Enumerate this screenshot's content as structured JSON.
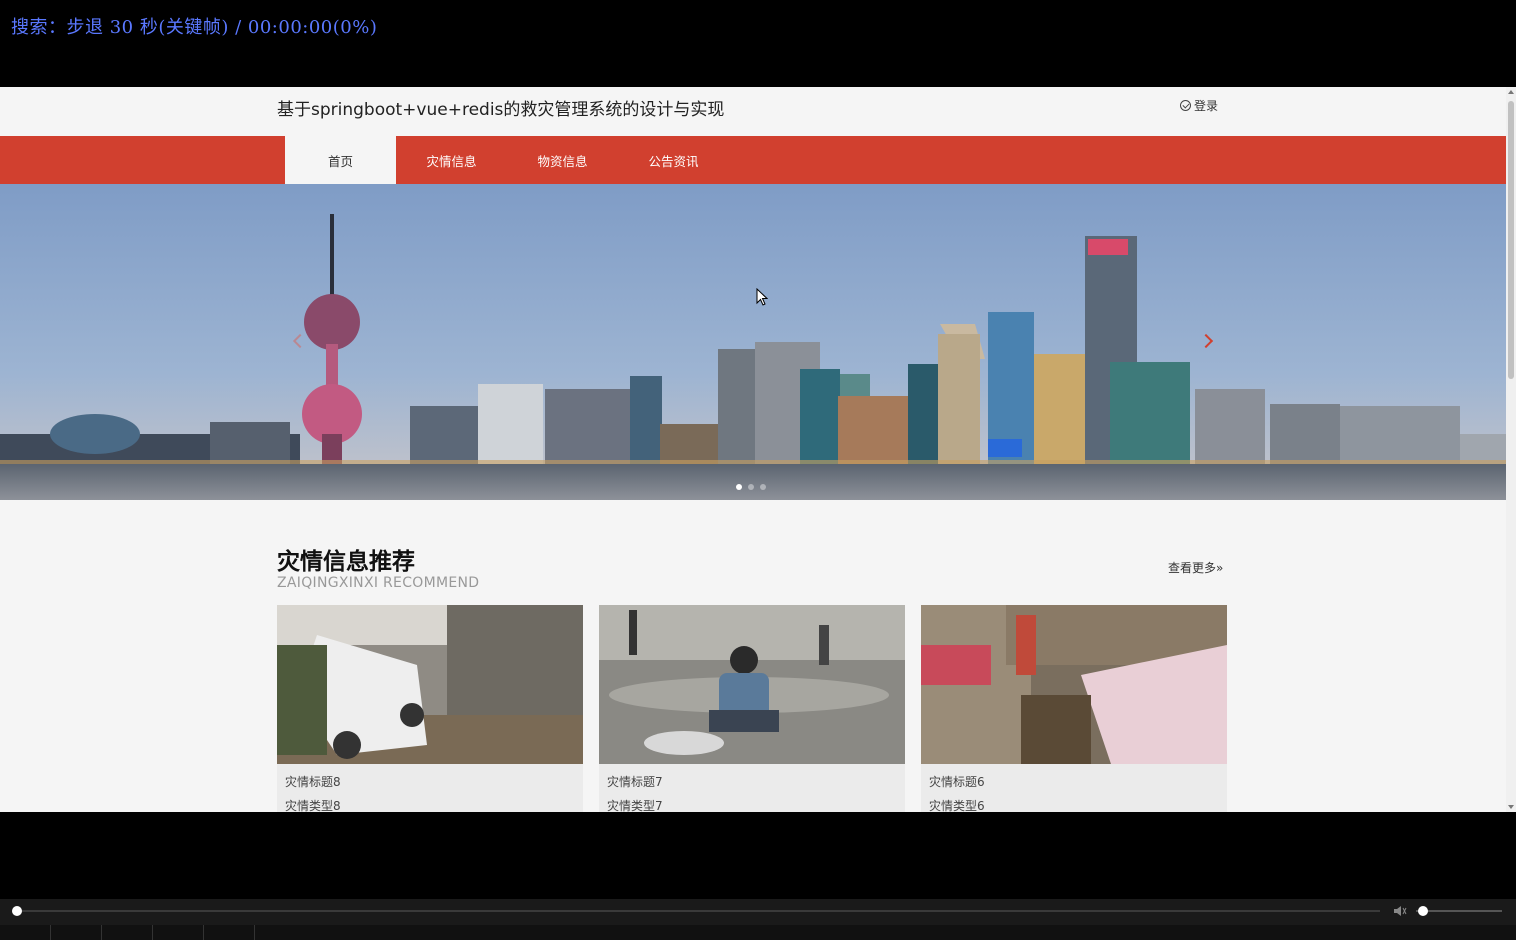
{
  "player": {
    "osd_text": "搜索：步退 30 秒(关键帧) / 00:00:00(0%)",
    "progress_fraction": 0.0,
    "volume_fraction": 0.02
  },
  "site": {
    "title": "基于springboot+vue+redis的救灾管理系统的设计与实现",
    "login_label": "登录",
    "nav": [
      {
        "label": "首页",
        "active": true
      },
      {
        "label": "灾情信息",
        "active": false
      },
      {
        "label": "物资信息",
        "active": false
      },
      {
        "label": "公告资讯",
        "active": false
      }
    ],
    "banner": {
      "slide_count": 3,
      "active_slide": 1
    },
    "section": {
      "title": "灾情信息推荐",
      "subtitle": "ZAIQINGXINXI RECOMMEND",
      "more_label": "查看更多»"
    },
    "cards": [
      {
        "title": "灾情标题8",
        "type": "灾情类型8"
      },
      {
        "title": "灾情标题7",
        "type": "灾情类型7"
      },
      {
        "title": "灾情标题6",
        "type": "灾情类型6"
      }
    ]
  },
  "colors": {
    "nav_red": "#d1402f",
    "osd_blue": "#5a78ff",
    "page_bg": "#f5f5f5"
  }
}
